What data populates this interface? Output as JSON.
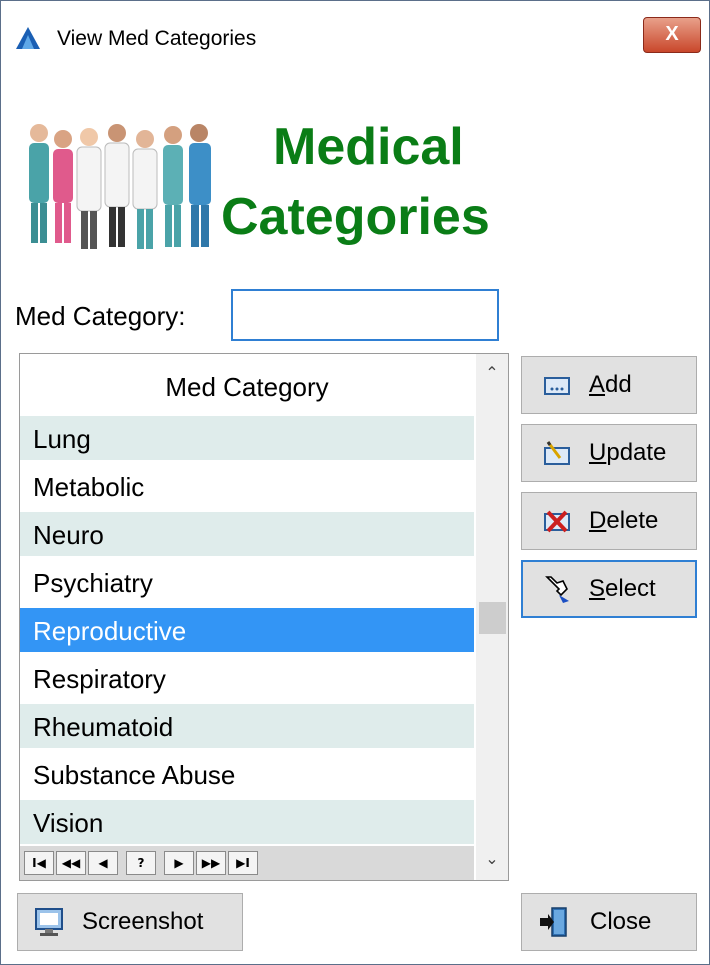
{
  "window": {
    "title": "View Med Categories",
    "close_glyph": "X"
  },
  "header": {
    "line1": "Medical",
    "line2": "Categories",
    "accent_color": "#0a7d16"
  },
  "search": {
    "label": "Med Category:",
    "value": ""
  },
  "grid": {
    "column_header": "Med Category",
    "rows": [
      "Lung",
      "Metabolic",
      "Neuro",
      "Psychiatry",
      "Reproductive",
      "Respiratory",
      "Rheumatoid",
      "Substance Abuse",
      "Vision"
    ],
    "selected_row": "Reproductive",
    "selection_color": "#3395f5",
    "nav_buttons": [
      "I◀",
      "◀◀",
      "◀",
      "?",
      "▶",
      "▶▶",
      "▶I"
    ]
  },
  "buttons": {
    "add_label": "Add",
    "add_mnemonic": "A",
    "update_label": "Update",
    "update_mnemonic": "U",
    "delete_label": "Delete",
    "delete_mnemonic": "D",
    "select_label": "Select",
    "select_mnemonic": "S",
    "screenshot_label": "Screenshot",
    "close_label": "Close"
  },
  "icons": {
    "app": "blue-triangle-icon",
    "banner": "doctors-group-illustration",
    "add": "add-record-icon",
    "update": "edit-record-icon",
    "delete": "delete-record-icon",
    "select": "hand-pointer-icon",
    "screenshot": "monitor-icon",
    "close": "exit-door-icon"
  }
}
